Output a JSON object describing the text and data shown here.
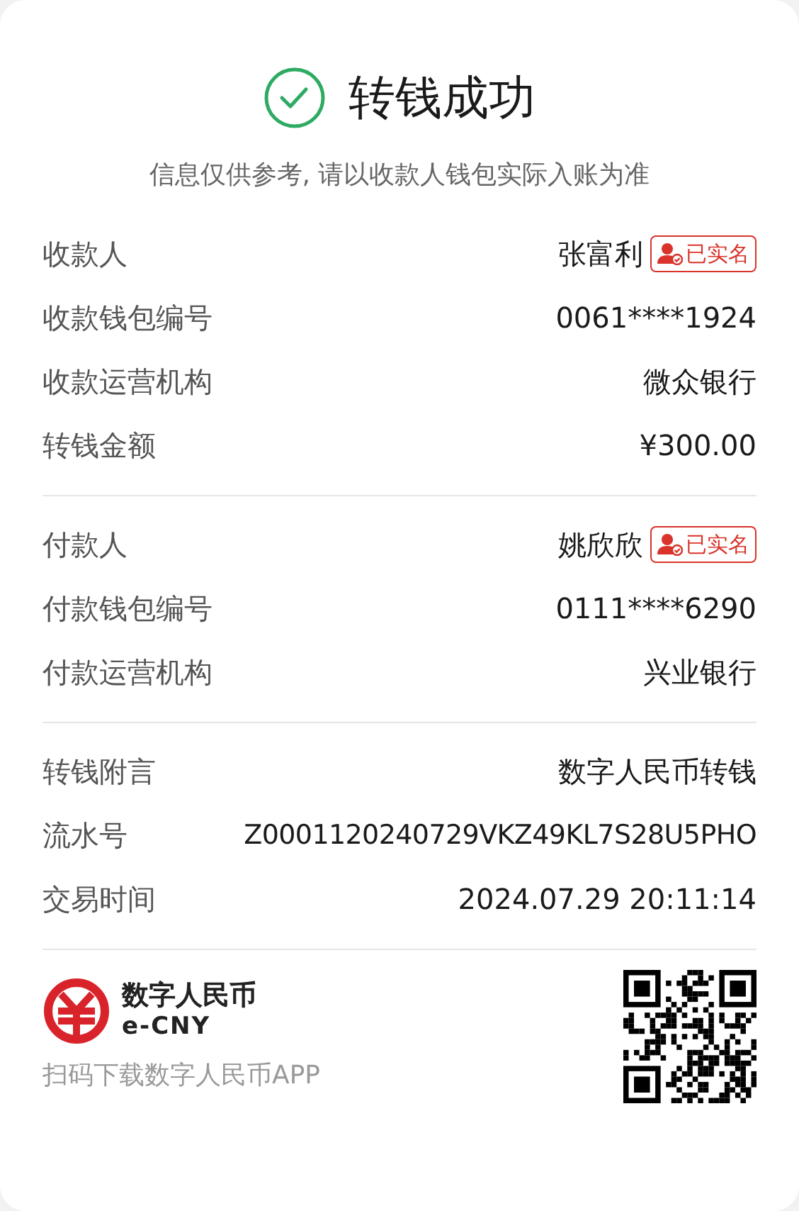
{
  "header": {
    "title": "转钱成功",
    "subtitle": "信息仅供参考, 请以收款人钱包实际入账为准"
  },
  "sections": [
    {
      "rows": [
        {
          "label": "收款人",
          "value": "张富利",
          "badge": "已实名"
        },
        {
          "label": "收款钱包编号",
          "value": "0061****1924"
        },
        {
          "label": "收款运营机构",
          "value": "微众银行"
        },
        {
          "label": "转钱金额",
          "value": "¥300.00"
        }
      ]
    },
    {
      "rows": [
        {
          "label": "付款人",
          "value": "姚欣欣",
          "badge": "已实名"
        },
        {
          "label": "付款钱包编号",
          "value": "0111****6290"
        },
        {
          "label": "付款运营机构",
          "value": "兴业银行"
        }
      ]
    },
    {
      "rows": [
        {
          "label": "转钱附言",
          "value": "数字人民币转钱"
        },
        {
          "label": "流水号",
          "value": "Z0001120240729VKZ49KL7S28U5PHO"
        },
        {
          "label": "交易时间",
          "value": "2024.07.29 20:11:14"
        }
      ]
    }
  ],
  "footer": {
    "brand_name": "数字人民币",
    "brand_sub": "e-CNY",
    "download_text": "扫码下载数字人民币APP"
  }
}
